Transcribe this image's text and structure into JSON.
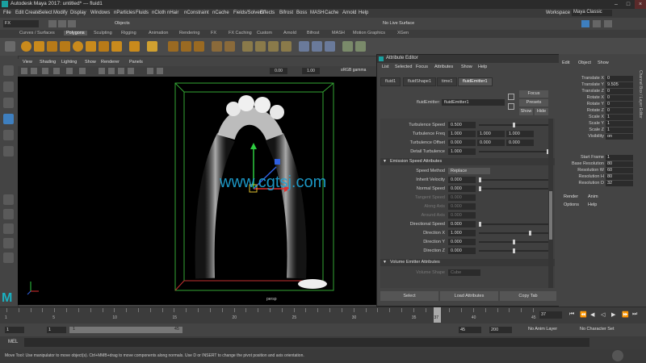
{
  "window": {
    "title": "Autodesk Maya 2017: untitled*  ---  fluid1",
    "workspace_label": "Workspace :",
    "workspace_value": "Maya Classic"
  },
  "menubar": [
    "File",
    "Edit",
    "Create",
    "Select",
    "Modify",
    "Display",
    "Windows",
    "nParticles",
    "Fluids",
    "nCloth",
    "nHair",
    "nConstraint",
    "nCache",
    "Fields/Solvers",
    "Effects",
    "Bifrost",
    "Boss",
    "MASH",
    "Cache",
    "Arnold",
    "Help"
  ],
  "status": {
    "menuset": "FX",
    "objects": "Objects",
    "live_surface": "No Live Surface"
  },
  "shelf_tabs": [
    "Curves / Surfaces",
    "Polygons",
    "Sculpting",
    "Rigging",
    "Animation",
    "Rendering",
    "FX",
    "FX Caching",
    "Custom",
    "Arnold",
    "Bifrost",
    "MASH",
    "Motion Graphics",
    "XGen"
  ],
  "shelf_active": "Polygons",
  "viewport": {
    "menus": [
      "View",
      "Shading",
      "Lighting",
      "Show",
      "Renderer",
      "Panels"
    ],
    "field1": "0.00",
    "field2": "1.00",
    "colorspace": "sRGB gamma",
    "camera_label": "persp",
    "watermark": "www.cgtsj.com"
  },
  "attribute_editor": {
    "title": "Attribute Editor",
    "menus": [
      "List",
      "Selected",
      "Focus",
      "Attributes",
      "Show",
      "Help"
    ],
    "tabs": [
      "fluid1",
      "fluidShape1",
      "time1",
      "fluidEmitter1"
    ],
    "active_tab": "fluidEmitter1",
    "node_label": "fluidEmitter:",
    "node_value": "fluidEmitter1",
    "focus_btn": "Focus",
    "presets_btn": "Presets",
    "show_btn": "Show",
    "hide_btn": "Hide",
    "turbulence": {
      "speed_label": "Turbulence Speed",
      "speed": "0.500",
      "freq_label": "Turbulence Freq",
      "freq": [
        "1.000",
        "1.000",
        "1.000"
      ],
      "offset_label": "Turbulence Offset",
      "offset": [
        "0.000",
        "0.000",
        "0.000"
      ],
      "detail_label": "Detail Turbulence",
      "detail": "1.000"
    },
    "emission_speed_section": "Emission Speed Attributes",
    "speed_method_label": "Speed Method",
    "speed_method_value": "Replace",
    "inherit_velocity_label": "Inherit Velocity",
    "inherit_velocity": "0.000",
    "normal_speed_label": "Normal Speed",
    "normal_speed": "0.000",
    "tangent_speed_label": "Tangent Speed",
    "tangent_speed": "0.000",
    "along_axis_label": "Along Axis",
    "along_axis": "0.000",
    "around_axis_label": "Around Axis",
    "around_axis": "0.000",
    "directional_speed_label": "Directional Speed",
    "directional_speed": "0.000",
    "direction_x_label": "Direction X",
    "direction_x": "1.000",
    "direction_y_label": "Direction Y",
    "direction_y": "0.000",
    "direction_z_label": "Direction Z",
    "direction_z": "0.000",
    "volume_section": "Volume Emitter Attributes",
    "volume_shape_label": "Volume Shape",
    "volume_shape_value": "Cube",
    "select_btn": "Select",
    "load_btn": "Load Attributes",
    "copy_btn": "Copy Tab"
  },
  "channel_box": {
    "menus": [
      "Edit",
      "Object",
      "Show"
    ],
    "rows": [
      {
        "name": "Translate X",
        "value": "0"
      },
      {
        "name": "Translate Y",
        "value": "9.505"
      },
      {
        "name": "Translate Z",
        "value": "0"
      },
      {
        "name": "Rotate X",
        "value": "0"
      },
      {
        "name": "Rotate Y",
        "value": "0"
      },
      {
        "name": "Rotate Z",
        "value": "0"
      },
      {
        "name": "Scale X",
        "value": "1"
      },
      {
        "name": "Scale Y",
        "value": "1"
      },
      {
        "name": "Scale Z",
        "value": "1"
      },
      {
        "name": "Visibility",
        "value": "on"
      }
    ],
    "rows2": [
      {
        "name": "Start Frame",
        "value": "1"
      },
      {
        "name": "Base Resolution",
        "value": "80"
      },
      {
        "name": "Resolution W",
        "value": "60"
      },
      {
        "name": "Resolution H",
        "value": "80"
      },
      {
        "name": "Resolution D",
        "value": "32"
      }
    ],
    "layer_menus": [
      "Render",
      "Anim"
    ],
    "layer_menus2": [
      "Options",
      "Help"
    ],
    "side_label": "Channel Box / Layer Editor"
  },
  "timeline": {
    "ticks": [
      "1",
      "5",
      "10",
      "15",
      "20",
      "25",
      "30",
      "35",
      "40",
      "45"
    ],
    "current_frame": "37",
    "current_frame_field": "37"
  },
  "range": {
    "start": "1",
    "start_inner": "1",
    "end_inner": "45",
    "end": "45",
    "max": "200",
    "anim_layer": "No Anim Layer",
    "char_set": "No Character Set"
  },
  "mel_label": "MEL",
  "help_text": "Move Tool: Use manipulator to move object(s). Ctrl+MMB+drag to move components along normals. Use D or INSERT to change the pivot position and axis orientation."
}
